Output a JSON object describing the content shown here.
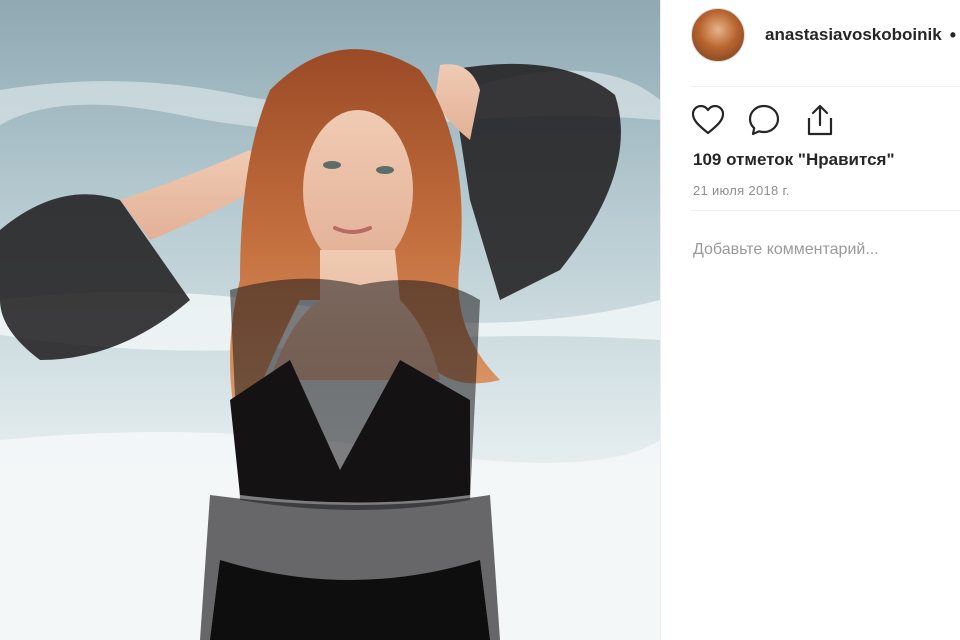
{
  "post": {
    "username": "anastasiavoskoboinik",
    "separator": "•",
    "likes_text": "109 отметок \"Нравится\"",
    "date": "21 июля 2018 г.",
    "comment_placeholder": "Добавьте комментарий..."
  },
  "icons": {
    "like": "heart-icon",
    "comment": "comment-icon",
    "share": "share-icon"
  },
  "colors": {
    "text": "#262626",
    "muted": "#8e8e8e",
    "divider": "#efefef"
  }
}
